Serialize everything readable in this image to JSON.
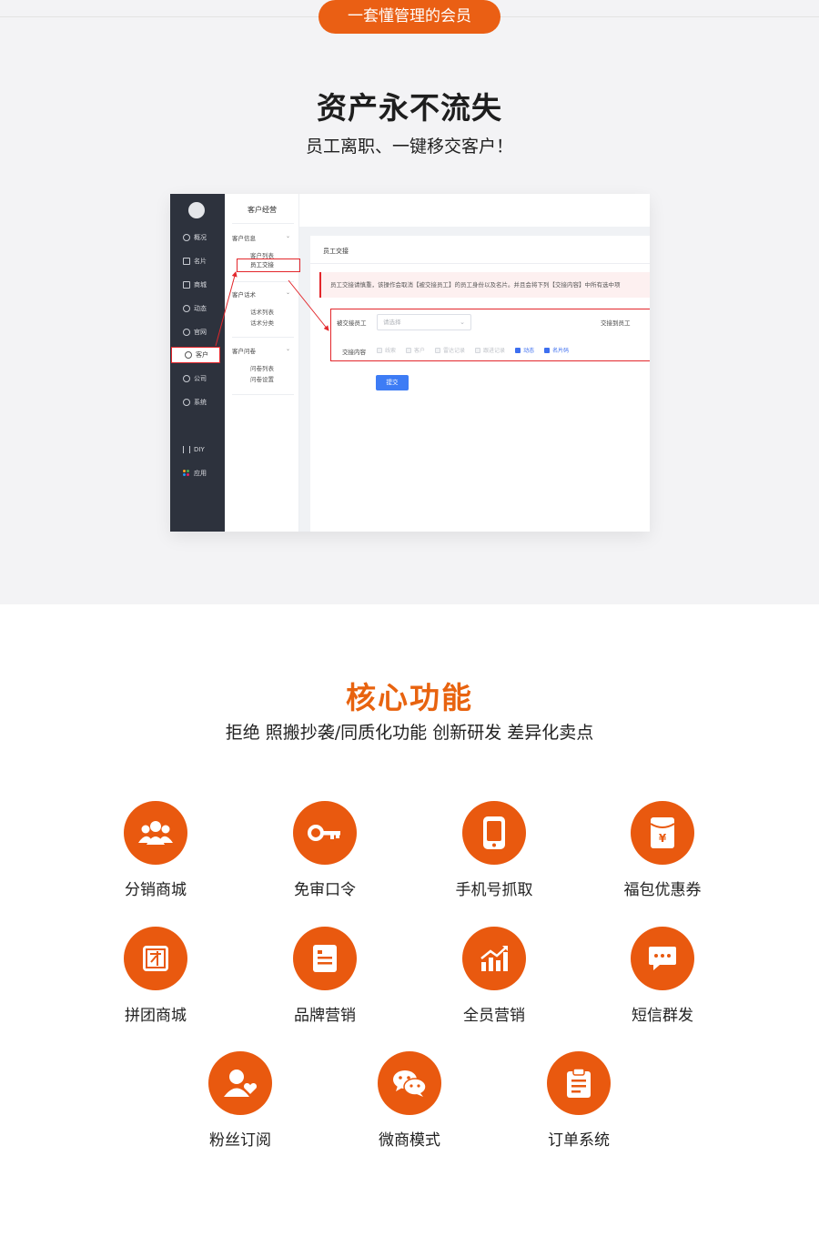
{
  "banner": {
    "pill": "一套懂管理的会员"
  },
  "hero": {
    "title": "资产永不流失",
    "subtitle": "员工离职、一键移交客户！"
  },
  "screenshot": {
    "nav": [
      {
        "label": "概况"
      },
      {
        "label": "名片"
      },
      {
        "label": "商城"
      },
      {
        "label": "动态"
      },
      {
        "label": "官网"
      },
      {
        "label": "客户"
      },
      {
        "label": "公司"
      },
      {
        "label": "系统"
      },
      {
        "label": "DIY"
      },
      {
        "label": "应用"
      }
    ],
    "sub": {
      "title": "客户经营",
      "group1": "客户信息",
      "g1_link1": "客户列表",
      "g1_link2": "员工交接",
      "group2": "客户话术",
      "g2_link1": "话术列表",
      "g2_link2": "话术分类",
      "group3": "客户问卷",
      "g3_link1": "问卷列表",
      "g3_link2": "问卷设置"
    },
    "panel": {
      "heading": "员工交接",
      "alert": "员工交接请慎重，该操作会取消【被交接员工】的员工身份以及名片。并且会将下列【交接内容】中所有选中项",
      "from_label": "被交接员工",
      "select_placeholder": "请选择",
      "to_label": "交接到员工",
      "content_label": "交接内容",
      "options": [
        {
          "label": "线索",
          "checked": false
        },
        {
          "label": "客户",
          "checked": false
        },
        {
          "label": "雷达记录",
          "checked": false
        },
        {
          "label": "跟进记录",
          "checked": false
        },
        {
          "label": "动态",
          "checked": true
        },
        {
          "label": "名片码",
          "checked": true
        }
      ],
      "submit": "提交"
    }
  },
  "core": {
    "title": "核心功能",
    "subtitle": "拒绝 照搬抄袭/同质化功能 创新研发 差异化卖点",
    "features": [
      {
        "label": "分销商城",
        "icon": "group-users-icon"
      },
      {
        "label": "免审口令",
        "icon": "key-icon"
      },
      {
        "label": "手机号抓取",
        "icon": "phone-icon"
      },
      {
        "label": "福包优惠券",
        "icon": "red-envelope-icon"
      },
      {
        "label": "拼团商城",
        "icon": "group-buy-icon"
      },
      {
        "label": "品牌营销",
        "icon": "document-icon"
      },
      {
        "label": "全员营销",
        "icon": "growth-chart-icon"
      },
      {
        "label": "短信群发",
        "icon": "message-bubble-icon"
      },
      {
        "label": "粉丝订阅",
        "icon": "user-heart-icon"
      },
      {
        "label": "微商模式",
        "icon": "wechat-icon"
      },
      {
        "label": "订单系统",
        "icon": "clipboard-icon"
      }
    ]
  },
  "colors": {
    "accent": "#e9590f",
    "highlight_red": "#e3262b",
    "link_blue": "#3d7cf5"
  }
}
